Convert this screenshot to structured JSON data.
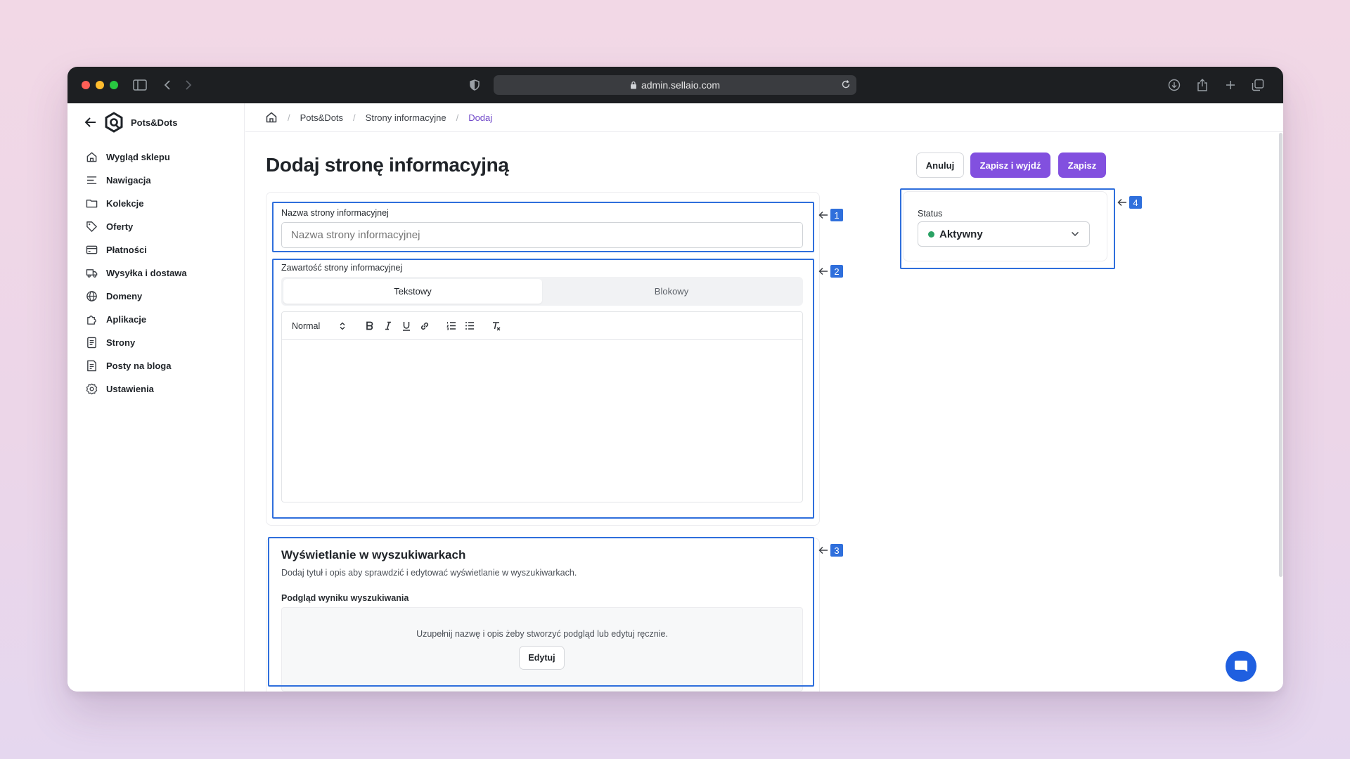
{
  "browser": {
    "url": "admin.sellaio.com",
    "traffic_colors": [
      "#ff5f57",
      "#febc2e",
      "#28c840"
    ]
  },
  "brand": {
    "name": "Pots&Dots"
  },
  "sidebar": {
    "items": [
      {
        "label": "Wygląd sklepu",
        "icon": "home-icon"
      },
      {
        "label": "Nawigacja",
        "icon": "menu-lines-icon"
      },
      {
        "label": "Kolekcje",
        "icon": "folder-icon"
      },
      {
        "label": "Oferty",
        "icon": "tag-icon"
      },
      {
        "label": "Płatności",
        "icon": "credit-card-icon"
      },
      {
        "label": "Wysyłka i dostawa",
        "icon": "truck-icon"
      },
      {
        "label": "Domeny",
        "icon": "globe-icon"
      },
      {
        "label": "Aplikacje",
        "icon": "puzzle-icon"
      },
      {
        "label": "Strony",
        "icon": "page-icon"
      },
      {
        "label": "Posty na bloga",
        "icon": "blog-icon"
      },
      {
        "label": "Ustawienia",
        "icon": "gear-icon"
      }
    ]
  },
  "breadcrumb": {
    "items": [
      "Pots&Dots",
      "Strony informacyjne",
      "Dodaj"
    ],
    "separator": "/"
  },
  "page": {
    "title": "Dodaj stronę informacyjną",
    "buttons": {
      "cancel": "Anuluj",
      "save_exit": "Zapisz i wyjdź",
      "save": "Zapisz"
    }
  },
  "form": {
    "name_label": "Nazwa strony informacyjnej",
    "name_placeholder": "Nazwa strony informacyjnej",
    "name_value": "",
    "content_label": "Zawartość strony informacyjnej",
    "tabs": [
      {
        "label": "Tekstowy",
        "active": true
      },
      {
        "label": "Blokowy",
        "active": false
      }
    ],
    "format_select": "Normal"
  },
  "seo": {
    "title": "Wyświetlanie w wyszukiwarkach",
    "description": "Dodaj tytuł i opis aby sprawdzić i edytować wyświetlanie w wyszukiwarkach.",
    "preview_label": "Podgląd wyniku wyszukiwania",
    "preview_hint": "Uzupełnij nazwę i opis żeby stworzyć podgląd lub edytuj ręcznie.",
    "edit_button": "Edytuj"
  },
  "status": {
    "label": "Status",
    "value": "Aktywny",
    "value_color": "#2aa264"
  },
  "annotations": {
    "markers": [
      "1",
      "2",
      "3",
      "4"
    ],
    "color": "#2f6fdc"
  },
  "colors": {
    "accent": "#8250df",
    "breadcrumb_active": "#7048c9",
    "chat_button": "#1f5fe0"
  }
}
